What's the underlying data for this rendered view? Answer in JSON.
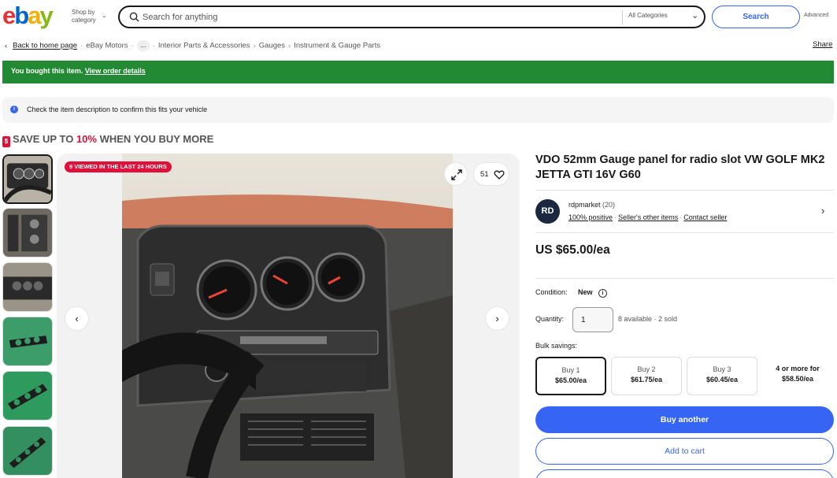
{
  "header": {
    "logo_letters": [
      "e",
      "b",
      "a",
      "y"
    ],
    "shop_by_line1": "Shop by",
    "shop_by_line2": "category",
    "search_placeholder": "Search for anything",
    "category": "All Categories",
    "search_button": "Search",
    "advanced": "Advanced"
  },
  "breadcrumb": {
    "back": "Back to home page",
    "items": [
      "eBay Motors",
      "...",
      "Interior Parts & Accessories",
      "Gauges",
      "Instrument & Gauge Parts"
    ],
    "share": "Share"
  },
  "banner": {
    "bought_text": "You bought this item.",
    "order_link": "View order details",
    "fitment_text": "Check the item description to confirm this fits your vehicle",
    "save_prefix": "SAVE UP TO",
    "save_pct": "10%",
    "save_suffix": "WHEN YOU BUY MORE"
  },
  "gallery": {
    "viewed_badge": "9 VIEWED IN THE LAST 24 HOURS",
    "watch_count": "51",
    "thumb_count": 6,
    "selected_thumb": 0
  },
  "listing": {
    "title": "VDO 52mm Gauge panel for radio slot VW GOLF MK2 JETTA GTI 16V G60",
    "seller_initials": "RD",
    "seller_name": "rdpmarket",
    "seller_feedback": "(20)",
    "positive": "100% positive",
    "other_items": "Seller's other items",
    "contact": "Contact seller",
    "price": "US $65.00/ea",
    "condition_label": "Condition:",
    "condition_value": "New",
    "quantity_label": "Quantity:",
    "quantity_value": "1",
    "availability": "8 available · 2 sold",
    "bulk_label": "Bulk savings:",
    "bulk_options": [
      {
        "qty": "Buy 1",
        "price": "$65.00/ea"
      },
      {
        "qty": "Buy 2",
        "price": "$61.75/ea"
      },
      {
        "qty": "Buy 3",
        "price": "$60.45/ea"
      },
      {
        "qty": "4 or more for",
        "price": "$58.50/ea"
      }
    ],
    "buy_button": "Buy another",
    "cart_button": "Add to cart"
  },
  "colors": {
    "ebay_red": "#e53238",
    "ebay_blue": "#0064d2",
    "ebay_yellow": "#f5af02",
    "ebay_green": "#86b817",
    "banner_green": "#238a34",
    "accent_blue": "#3665f3",
    "badge_red": "#e0103a"
  }
}
